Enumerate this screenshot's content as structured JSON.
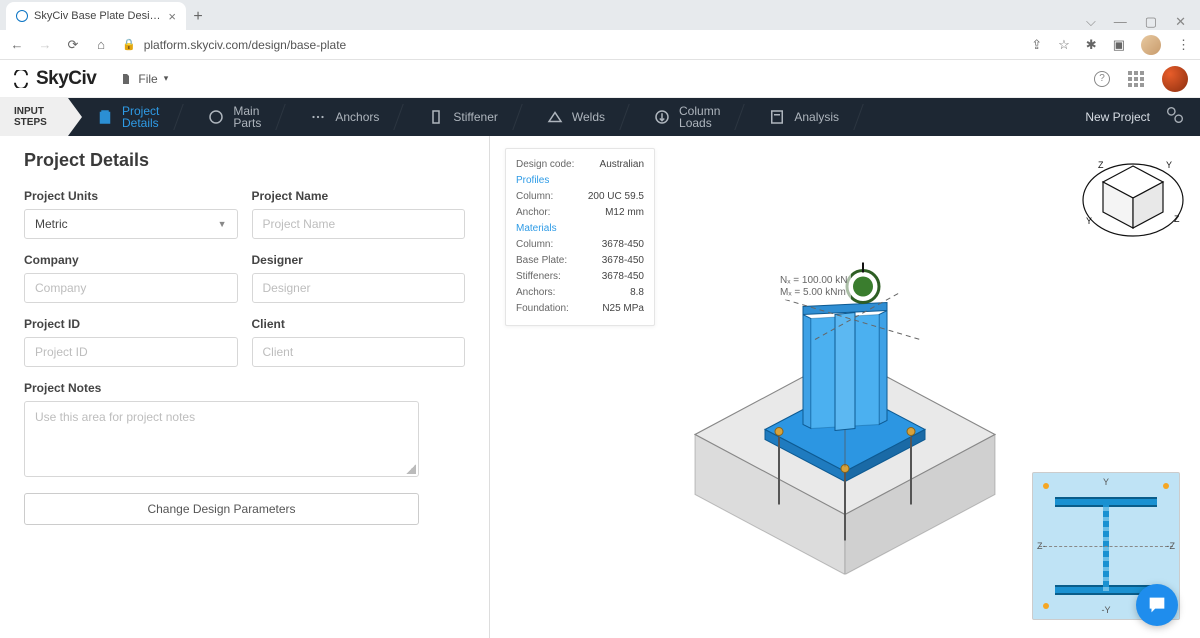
{
  "browser": {
    "tab_title": "SkyCiv Base Plate Design | SkyCi...",
    "url": "platform.skyciv.com/design/base-plate"
  },
  "app": {
    "brand": "SkyCiv",
    "file_menu": "File"
  },
  "steps": {
    "input_steps_l1": "INPUT",
    "input_steps_l2": "STEPS",
    "project_l1": "Project",
    "project_l2": "Details",
    "main_l1": "Main",
    "main_l2": "Parts",
    "anchors": "Anchors",
    "stiffener": "Stiffener",
    "welds": "Welds",
    "column_l1": "Column",
    "column_l2": "Loads",
    "analysis": "Analysis",
    "new_project": "New Project"
  },
  "form": {
    "title": "Project Details",
    "units_label": "Project Units",
    "units_value": "Metric",
    "name_label": "Project Name",
    "name_placeholder": "Project Name",
    "company_label": "Company",
    "company_placeholder": "Company",
    "designer_label": "Designer",
    "designer_placeholder": "Designer",
    "projectid_label": "Project ID",
    "projectid_placeholder": "Project ID",
    "client_label": "Client",
    "client_placeholder": "Client",
    "notes_label": "Project Notes",
    "notes_placeholder": "Use this area for project notes",
    "change_btn": "Change Design Parameters"
  },
  "info": {
    "design_code_k": "Design code:",
    "design_code_v": "Australian",
    "profiles": "Profiles",
    "column_k": "Column:",
    "column_v": "200 UC 59.5",
    "anchor_k": "Anchor:",
    "anchor_v": "M12 mm",
    "materials": "Materials",
    "mat_column_k": "Column:",
    "mat_column_v": "3678-450",
    "baseplate_k": "Base Plate:",
    "baseplate_v": "3678-450",
    "stiff_k": "Stiffeners:",
    "stiff_v": "3678-450",
    "anchors_k": "Anchors:",
    "anchors_v": "8.8",
    "foundation_k": "Foundation:",
    "foundation_v": "N25 MPa"
  },
  "loads": {
    "line1": "Nₓ = 100.00 kN",
    "line2": "Mₓ = 5.00 kNm"
  },
  "mini": {
    "y_top": "Y",
    "y_bot": "-Y",
    "z_left": "Z-",
    "z_right": "-Z"
  }
}
